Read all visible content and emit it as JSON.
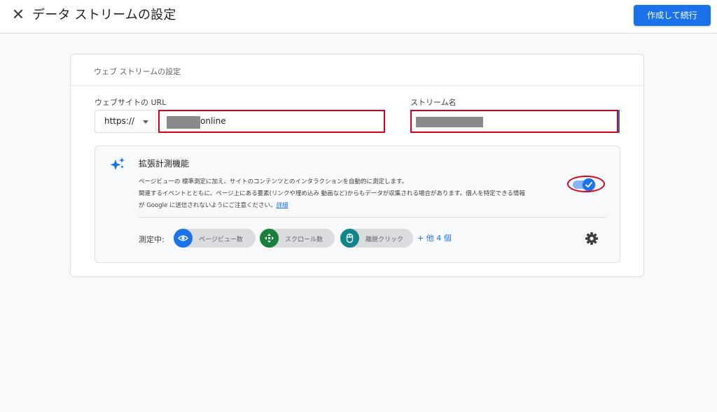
{
  "header": {
    "close_icon": "close-icon",
    "title": "データ ストリームの設定",
    "primary_button": "作成して続行",
    "accent_color": "#1a73e8"
  },
  "card": {
    "title": "ウェブ ストリームの設定",
    "url_label": "ウェブサイトの URL",
    "protocol": "https://",
    "url_value": "online",
    "stream_name_label": "ストリーム名",
    "stream_name_value": ""
  },
  "enhanced": {
    "icon": "sparkle-icon",
    "title": "拡張計測機能",
    "description_lines": [
      "ページビューの 標準測定に加え、サイトのコンテンツとのインタラクションを自動的に測定します。",
      "関連するイベントとともに、ページ上にある要素(リンクや埋め込み 動画など)からもデータが収集される場合があります。個人を特定できる情報",
      "が Google に送信されないようにご注意ください。"
    ],
    "details_link": "詳細",
    "toggle_on": true,
    "measuring_label": "測定中:",
    "chips": [
      {
        "label": "ページビュー数",
        "icon": "eye-icon",
        "color": "#1a73e8"
      },
      {
        "label": "スクロール数",
        "icon": "scroll-arrows-icon",
        "color": "#188038"
      },
      {
        "label": "離脱クリック",
        "icon": "mouse-icon",
        "color": "#12858a"
      }
    ],
    "more_link": "+ 他 4 個",
    "settings_icon": "gear-icon"
  },
  "annotation_color": "#d9001b"
}
